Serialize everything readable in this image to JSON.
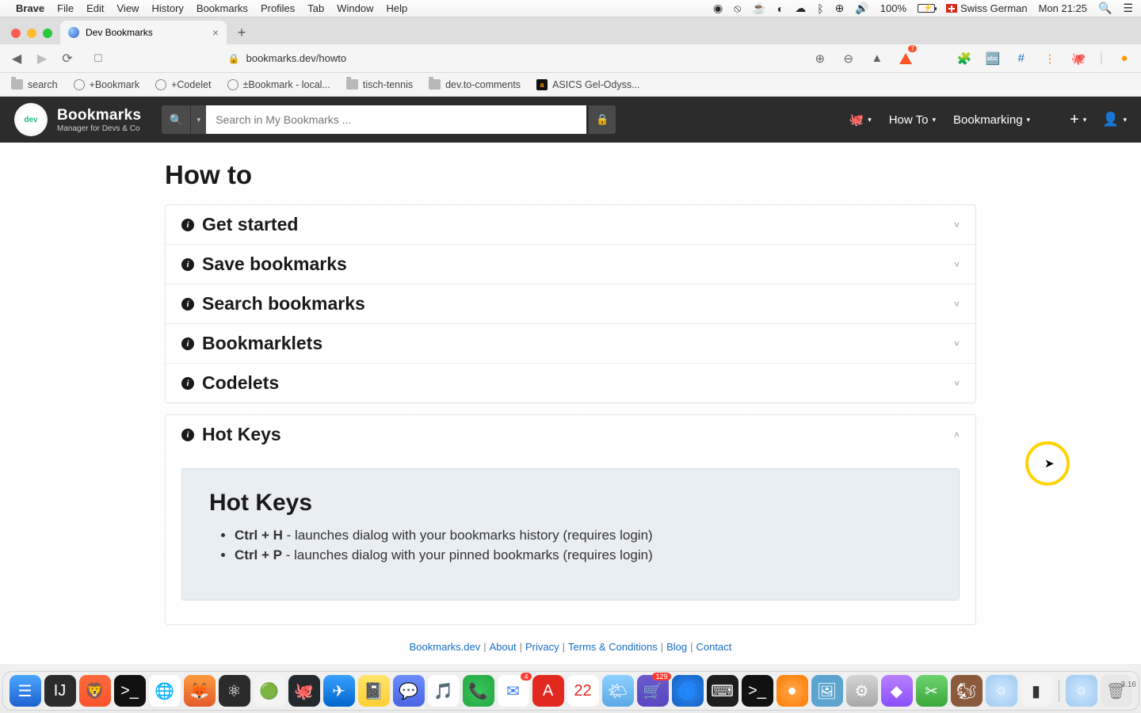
{
  "menubar": {
    "app": "Brave",
    "items": [
      "File",
      "Edit",
      "View",
      "History",
      "Bookmarks",
      "Profiles",
      "Tab",
      "Window",
      "Help"
    ],
    "battery": "100%",
    "lang": "Swiss German",
    "clock": "Mon 21:25"
  },
  "browser": {
    "tab_title": "Dev Bookmarks",
    "url": "bookmarks.dev/howto",
    "bookmarks_bar": [
      {
        "icon": "folder",
        "label": "search"
      },
      {
        "icon": "globe",
        "label": "+Bookmark"
      },
      {
        "icon": "globe",
        "label": "+Codelet"
      },
      {
        "icon": "globe",
        "label": "±Bookmark - local..."
      },
      {
        "icon": "folder",
        "label": "tisch-tennis"
      },
      {
        "icon": "folder",
        "label": "dev.to-comments"
      },
      {
        "icon": "amazon",
        "label": "ASICS Gel-Odyss..."
      }
    ],
    "shield_count": "7"
  },
  "nav": {
    "brand": "Bookmarks",
    "brand_sub": "Manager for Devs & Co",
    "logo_text": "dev",
    "search_placeholder": "Search in My Bookmarks ...",
    "links": {
      "howto": "How To",
      "bookmarking": "Bookmarking"
    }
  },
  "page": {
    "title": "How to",
    "sections": [
      {
        "label": "Get started",
        "open": false
      },
      {
        "label": "Save bookmarks",
        "open": false
      },
      {
        "label": "Search bookmarks",
        "open": false
      },
      {
        "label": "Bookmarklets",
        "open": false
      },
      {
        "label": "Codelets",
        "open": false
      }
    ],
    "hotkeys": {
      "label": "Hot Keys",
      "panel_title": "Hot Keys",
      "items": [
        {
          "combo": "Ctrl + H",
          "desc": " - launches dialog with your bookmarks history (requires login)"
        },
        {
          "combo": "Ctrl + P",
          "desc": " - launches dialog with your pinned bookmarks (requires login)"
        }
      ]
    }
  },
  "footer": {
    "links": [
      "Bookmarks.dev",
      "About",
      "Privacy",
      "Terms & Conditions",
      "Blog",
      "Contact"
    ]
  },
  "dock": {
    "apps": [
      {
        "bg": "linear-gradient(#4aa7ff,#1e62d0)",
        "char": "☰"
      },
      {
        "bg": "#2b2b2b",
        "char": "IJ"
      },
      {
        "bg": "linear-gradient(#ff6a3d,#fb542b)",
        "char": "🦁"
      },
      {
        "bg": "#111",
        "char": ">_"
      },
      {
        "bg": "#fff",
        "char": "🌐",
        "fg": "#4285f4"
      },
      {
        "bg": "linear-gradient(#ff9a3d,#e55b2b)",
        "char": "🦊"
      },
      {
        "bg": "#2b2b2b",
        "char": "⚛"
      },
      {
        "bg": "#f4f4f4",
        "char": "🟢",
        "fg": "#2da44e"
      },
      {
        "bg": "#24292e",
        "char": "🐙"
      },
      {
        "bg": "linear-gradient(#3aa0ff,#0066cc)",
        "char": "✈"
      },
      {
        "bg": "linear-gradient(#ffe46b,#ffcf33)",
        "char": "📓"
      },
      {
        "bg": "linear-gradient(#6b8cff,#4a65e0)",
        "char": "💬"
      },
      {
        "bg": "#fff",
        "char": "🎵",
        "fg": "#fa243c"
      },
      {
        "bg": "radial-gradient(#34c759,#28a745)",
        "char": "📞"
      },
      {
        "bg": "#fff",
        "char": "✉",
        "fg": "#3478f6",
        "badge": "4"
      },
      {
        "bg": "#e1291f",
        "char": "A"
      },
      {
        "bg": "#fff",
        "char": "22",
        "fg": "#e1291f"
      },
      {
        "bg": "linear-gradient(#8dd0ff,#5aa9e6)",
        "char": "🌤"
      },
      {
        "bg": "linear-gradient(#6a5acd,#5848c2)",
        "char": "🛒",
        "badge": "129"
      },
      {
        "bg": "radial-gradient(#2b8cff,#1560bd)",
        "char": "🌀"
      },
      {
        "bg": "#1e1e1e",
        "char": "⌨"
      },
      {
        "bg": "#111",
        "char": ">_"
      },
      {
        "bg": "radial-gradient(#ffa94d,#ff7b00)",
        "char": "●"
      },
      {
        "bg": "#5ba4cf",
        "char": "🖼"
      },
      {
        "bg": "linear-gradient(#d4d4d4,#a8a8a8)",
        "char": "⚙"
      },
      {
        "bg": "linear-gradient(#b880ff,#8a4fff)",
        "char": "◆"
      },
      {
        "bg": "linear-gradient(#6dd36d,#3aa83a)",
        "char": "✂"
      },
      {
        "bg": "#8b5a3c",
        "char": "🐿"
      },
      {
        "bg": "radial-gradient(#cfe8ff,#9ec8ee)",
        "char": "○"
      },
      {
        "bg": "#f4f4f4",
        "char": "▮",
        "fg": "#333"
      },
      {
        "bg": "radial-gradient(#cfe8ff,#9ec8ee)",
        "char": "○"
      },
      {
        "bg": "#e8e8e8",
        "char": "🗑",
        "fg": "#888"
      }
    ]
  },
  "corner_time": "3.16"
}
